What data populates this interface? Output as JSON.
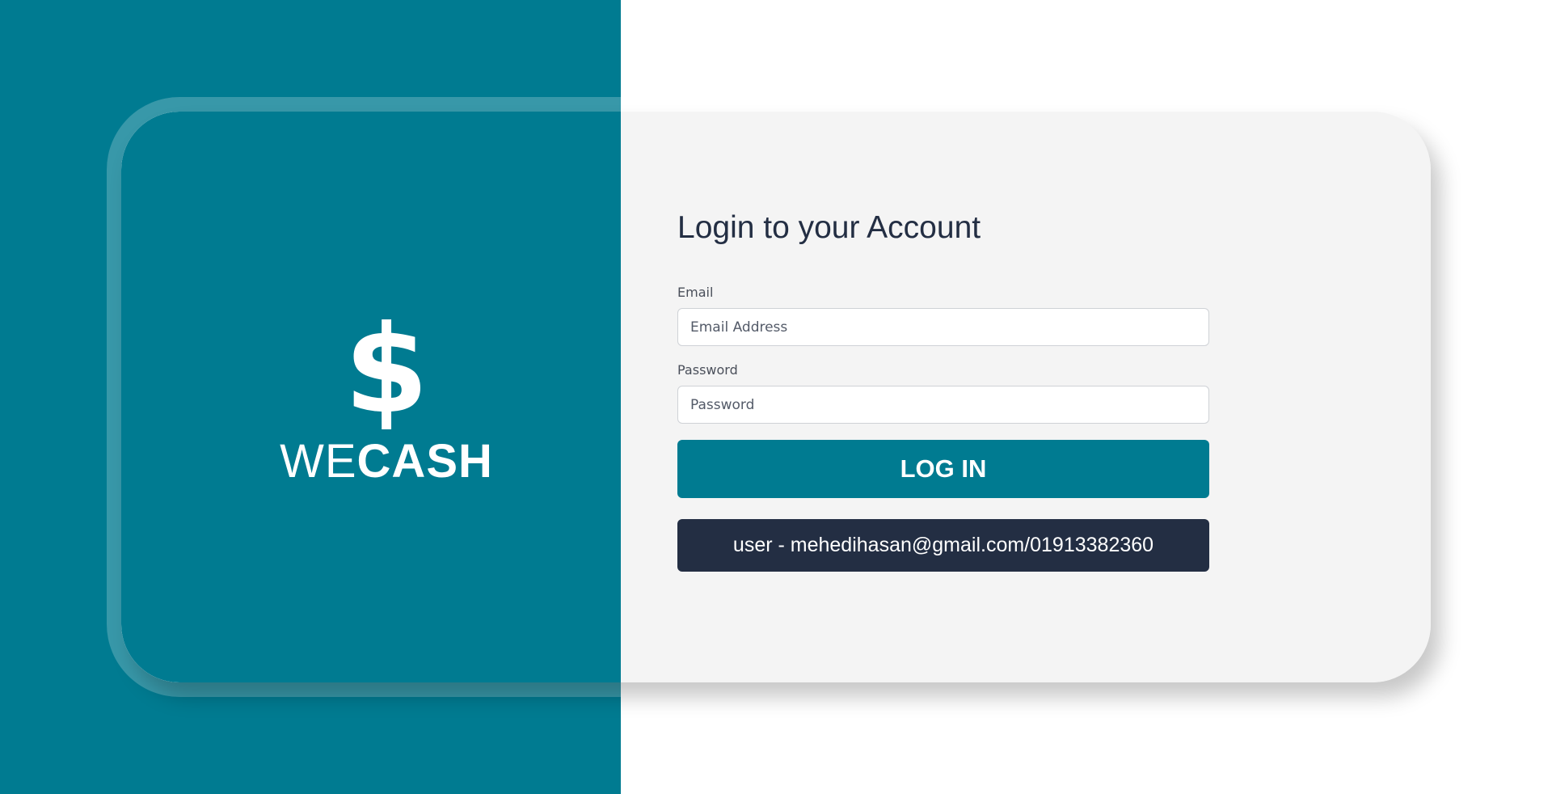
{
  "brand": {
    "icon": "dollar-icon",
    "glyph": "$",
    "name_light": "WE",
    "name_bold": "CASH"
  },
  "form": {
    "title": "Login to your Account",
    "email": {
      "label": "Email",
      "placeholder": "Email Address",
      "value": ""
    },
    "password": {
      "label": "Password",
      "placeholder": "Password",
      "value": ""
    },
    "submit_label": "LOG IN",
    "demo_credentials": "user - mehedihasan@gmail.com/01913382360"
  },
  "colors": {
    "primary": "#007b91",
    "dark": "#232e43",
    "card_background": "#f4f4f4",
    "page_background": "#ffffff"
  }
}
